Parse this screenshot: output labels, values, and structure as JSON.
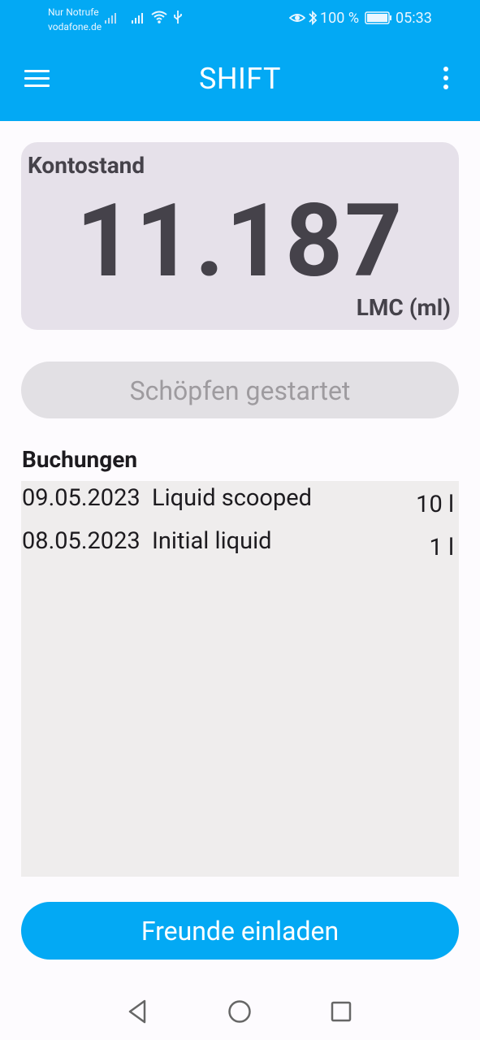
{
  "status_bar": {
    "carrier_line1": "Nur Notrufe",
    "carrier_line2": "vodafone.de",
    "battery": "100 %",
    "time": "05:33",
    "icons": [
      "signal-icon",
      "wifi-icon",
      "usb-icon",
      "eye-comfort-icon",
      "bluetooth-icon",
      "battery-icon"
    ]
  },
  "app_bar": {
    "title": "SHIFT",
    "menu_icon": "hamburger-menu-icon",
    "more_icon": "more-vertical-icon"
  },
  "balance": {
    "label": "Kontostand",
    "value": "11.187",
    "unit": "LMC (ml)"
  },
  "status_button": {
    "label": "Schöpfen gestartet"
  },
  "bookings": {
    "title": "Buchungen",
    "rows": [
      {
        "date": "09.05.2023",
        "description": "Liquid scooped",
        "amount": "10 l"
      },
      {
        "date": "08.05.2023",
        "description": "Initial liquid",
        "amount": "1 l"
      }
    ]
  },
  "invite_button": {
    "label": "Freunde einladen"
  },
  "navigation": {
    "items": [
      "back-icon",
      "home-icon",
      "recent-apps-icon"
    ]
  },
  "colors": {
    "primary": "#03a9f4",
    "card": "#e6e1ea",
    "text_dark": "#45424a",
    "list_bg": "#efeded"
  }
}
